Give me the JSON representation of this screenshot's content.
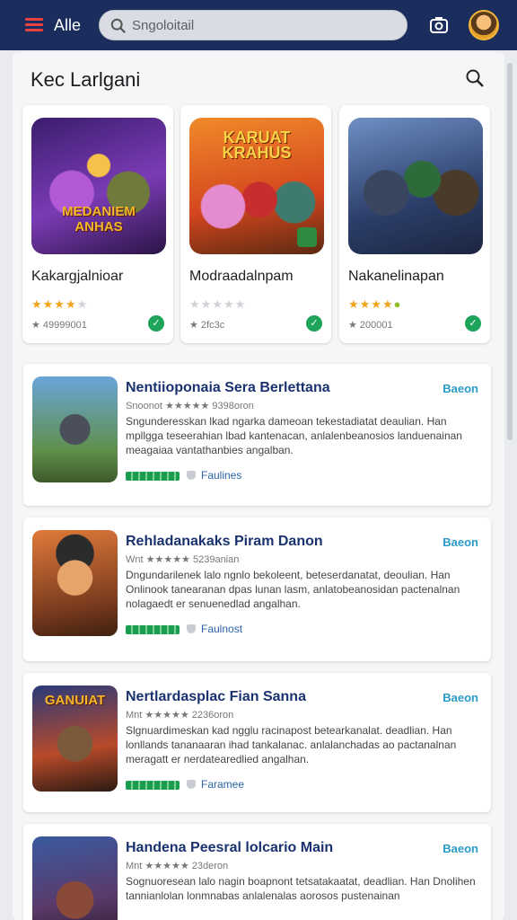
{
  "header": {
    "app_title": "Alle",
    "search_placeholder": "Sngoloitail"
  },
  "section": {
    "title": "Kec Larlgani"
  },
  "featured": [
    {
      "name": "Kakargjalnioar",
      "stars_filled": 4,
      "count": "★ 49999001",
      "badge": "✓"
    },
    {
      "name": "Modraadalnpam",
      "stars_filled": 0,
      "count": "★ 2fc3c",
      "badge": "✓"
    },
    {
      "name": "Nakanelinapan",
      "stars_filled": 4,
      "count": "★ 200001",
      "badge": "✓"
    }
  ],
  "listings": [
    {
      "title": "Nentiioponaia Sera Berlettana",
      "action": "Baeon",
      "rating_text": "Snoonot ★★★★★ 9398oron",
      "description": "Sngunderesskan lkad ngarka dameoan tekestadiatat deaulian. Han mpllgga teseerahian lbad kantenacan, anlalenbeanosios landuenainan meagaiaa vantathanbies angalban.",
      "tag": "Faulines"
    },
    {
      "title": "Rehladanakaks Piram Danon",
      "action": "Baeon",
      "rating_text": "Wnt ★★★★★ 5239anian",
      "description": "Dngundarilenek lalo ngnlo bekoleent, beteserdanatat, deoulian. Han Onlinook tanearanan dpas lunan lasm, anlatobeanosidan pactenalnan nolagaedt er senuenedlad angalhan.",
      "tag": "Faulnost"
    },
    {
      "title": "Nertlardasplac Fian Sanna",
      "action": "Baeon",
      "rating_text": "Mnt ★★★★★ 2236oron",
      "description": "Slgnuardimeskan kad ngglu racinapost betearkanalat. deadlian. Han lonllands tananaaran ihad tankalanac. anlalanchadas ao pactanalnan meragatt er nerdatearedlied angalhan.",
      "tag": "Faramee"
    },
    {
      "title": "Handena Peesral lolcario Main",
      "action": "Baeon",
      "rating_text": "Mnt ★★★★★ 23deron",
      "description": "Sognuoresean lalo nagin boapnont tetsatakaatat, deadlian. Han Dnolihen tannianlolan lonmnabas anlalenalas aorosos pustenainan ",
      "tag": ""
    }
  ],
  "colors": {
    "header": "#1a2d5c",
    "accent": "#2b9cc9",
    "title": "#1a3370",
    "badge": "#1ea35a",
    "star": "#f2a51a"
  }
}
